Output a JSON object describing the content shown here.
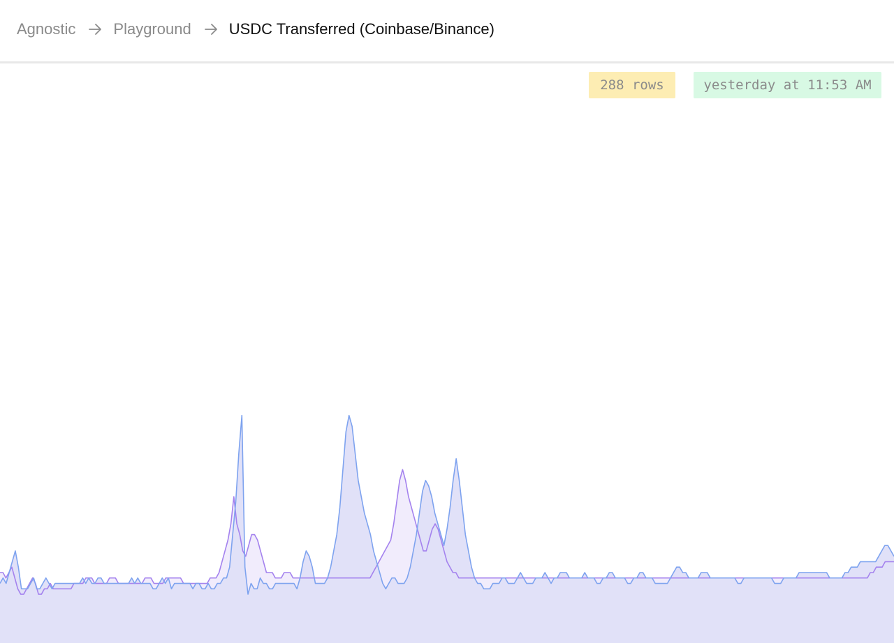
{
  "breadcrumb": {
    "items": [
      "Agnostic",
      "Playground"
    ],
    "current": "USDC Transferred (Coinbase/Binance)"
  },
  "badges": {
    "rows": "288 rows",
    "updated": "yesterday at 11:53 AM"
  },
  "colors": {
    "series_blue": "#7ea3ef",
    "series_purple": "#a482ee",
    "fill_blue": "#e1e1f8",
    "fill_purple": "#f1ecfc",
    "rows_badge_bg": "#fdedb3",
    "time_badge_bg": "#d8f9e4"
  },
  "icons": {
    "separator": "arrow-right-icon"
  },
  "chart_data": {
    "type": "area",
    "title": "",
    "xlabel": "",
    "ylabel": "",
    "ylim": [
      0,
      100
    ],
    "series": [
      {
        "color": "#7ea3ef",
        "values": [
          11,
          12,
          11,
          13,
          15,
          17,
          14,
          10,
          10,
          10,
          11,
          12,
          10,
          10,
          11,
          12,
          11,
          10,
          11,
          11,
          11,
          11,
          11,
          11,
          11,
          11,
          11,
          12,
          11,
          12,
          11,
          11,
          12,
          12,
          11,
          11,
          11,
          11,
          11,
          11,
          11,
          11,
          11,
          12,
          11,
          12,
          11,
          11,
          11,
          11,
          10,
          10,
          11,
          12,
          11,
          12,
          10,
          11,
          11,
          11,
          11,
          11,
          11,
          10,
          11,
          11,
          10,
          10,
          11,
          10,
          10,
          11,
          11,
          12,
          12,
          14,
          20,
          26,
          35,
          42,
          14,
          9,
          11,
          10,
          10,
          12,
          11,
          11,
          10,
          10,
          11,
          11,
          11,
          11,
          11,
          11,
          11,
          10,
          12,
          15,
          17,
          16,
          14,
          11,
          11,
          11,
          11,
          12,
          14,
          17,
          20,
          25,
          32,
          39,
          42,
          40,
          35,
          30,
          27,
          24,
          22,
          20,
          17,
          15,
          13,
          11,
          10,
          11,
          12,
          12,
          11,
          11,
          11,
          12,
          14,
          17,
          20,
          24,
          28,
          30,
          29,
          27,
          24,
          22,
          20,
          18,
          21,
          25,
          30,
          34,
          30,
          25,
          20,
          17,
          14,
          12,
          11,
          11,
          10,
          10,
          10,
          11,
          11,
          11,
          12,
          12,
          11,
          11,
          11,
          12,
          13,
          12,
          11,
          11,
          11,
          12,
          12,
          12,
          13,
          12,
          11,
          12,
          12,
          13,
          13,
          13,
          12,
          12,
          12,
          12,
          12,
          13,
          12,
          12,
          12,
          11,
          11,
          12,
          12,
          13,
          13,
          12,
          12,
          12,
          12,
          11,
          11,
          12,
          12,
          13,
          13,
          12,
          12,
          12,
          11,
          11,
          11,
          11,
          11,
          12,
          13,
          14,
          14,
          13,
          13,
          12,
          12,
          12,
          12,
          13,
          13,
          13,
          12,
          12,
          12,
          12,
          12,
          12,
          12,
          12,
          12,
          11,
          11,
          12,
          12,
          12,
          12,
          12,
          12,
          12,
          12,
          12,
          12,
          11,
          11,
          11,
          12,
          12,
          12,
          12,
          12,
          13,
          13,
          13,
          13,
          13,
          13,
          13,
          13,
          13,
          13,
          12,
          12,
          12,
          12,
          12,
          13,
          13,
          14,
          14,
          14,
          15,
          15,
          15,
          15,
          15,
          15,
          16,
          17,
          18,
          18,
          17,
          16
        ]
      },
      {
        "color": "#a482ee",
        "values": [
          13,
          13,
          12,
          13,
          14,
          12,
          10,
          9,
          9,
          10,
          11,
          12,
          11,
          9,
          9,
          10,
          10,
          11,
          10,
          10,
          10,
          10,
          10,
          10,
          10,
          11,
          11,
          11,
          11,
          12,
          12,
          12,
          11,
          11,
          11,
          11,
          11,
          12,
          12,
          12,
          11,
          11,
          11,
          11,
          11,
          11,
          11,
          11,
          11,
          12,
          12,
          12,
          11,
          11,
          11,
          11,
          12,
          12,
          12,
          12,
          12,
          12,
          11,
          11,
          11,
          11,
          11,
          11,
          11,
          11,
          11,
          12,
          12,
          12,
          13,
          15,
          17,
          19,
          22,
          27,
          22,
          20,
          17,
          16,
          18,
          20,
          20,
          19,
          17,
          15,
          13,
          13,
          13,
          12,
          12,
          12,
          13,
          13,
          13,
          12,
          12,
          12,
          12,
          12,
          12,
          12,
          12,
          12,
          12,
          12,
          12,
          12,
          12,
          12,
          12,
          12,
          12,
          12,
          12,
          12,
          12,
          12,
          12,
          12,
          12,
          12,
          13,
          14,
          15,
          16,
          17,
          18,
          19,
          22,
          26,
          30,
          32,
          30,
          27,
          25,
          23,
          21,
          19,
          17,
          17,
          19,
          21,
          22,
          21,
          19,
          17,
          15,
          14,
          13,
          13,
          12,
          12,
          12,
          12,
          12,
          12,
          12,
          12,
          12,
          12,
          12,
          12,
          12,
          12,
          12,
          12,
          12,
          12,
          12,
          12,
          12,
          12,
          12,
          12,
          12,
          12,
          12,
          12,
          12,
          12,
          12,
          12,
          12,
          12,
          12,
          12,
          12,
          12,
          12,
          12,
          12,
          12,
          12,
          12,
          12,
          12,
          12,
          12,
          12,
          12,
          12,
          12,
          12,
          12,
          12,
          12,
          12,
          12,
          12,
          12,
          12,
          12,
          12,
          12,
          12,
          12,
          12,
          12,
          12,
          12,
          12,
          12,
          12,
          12,
          12,
          12,
          12,
          12,
          12,
          12,
          12,
          12,
          12,
          12,
          12,
          12,
          12,
          12,
          12,
          12,
          12,
          12,
          12,
          12,
          12,
          12,
          12,
          12,
          12,
          12,
          12,
          12,
          12,
          12,
          12,
          12,
          12,
          12,
          12,
          12,
          12,
          12,
          12,
          12,
          12,
          12,
          12,
          12,
          12,
          12,
          12,
          12,
          12,
          12,
          12,
          12,
          12,
          12,
          12,
          12,
          12,
          12,
          12,
          12,
          12,
          12,
          12,
          12,
          12,
          13,
          13,
          14,
          14,
          14,
          15,
          15,
          15,
          15
        ]
      }
    ]
  }
}
